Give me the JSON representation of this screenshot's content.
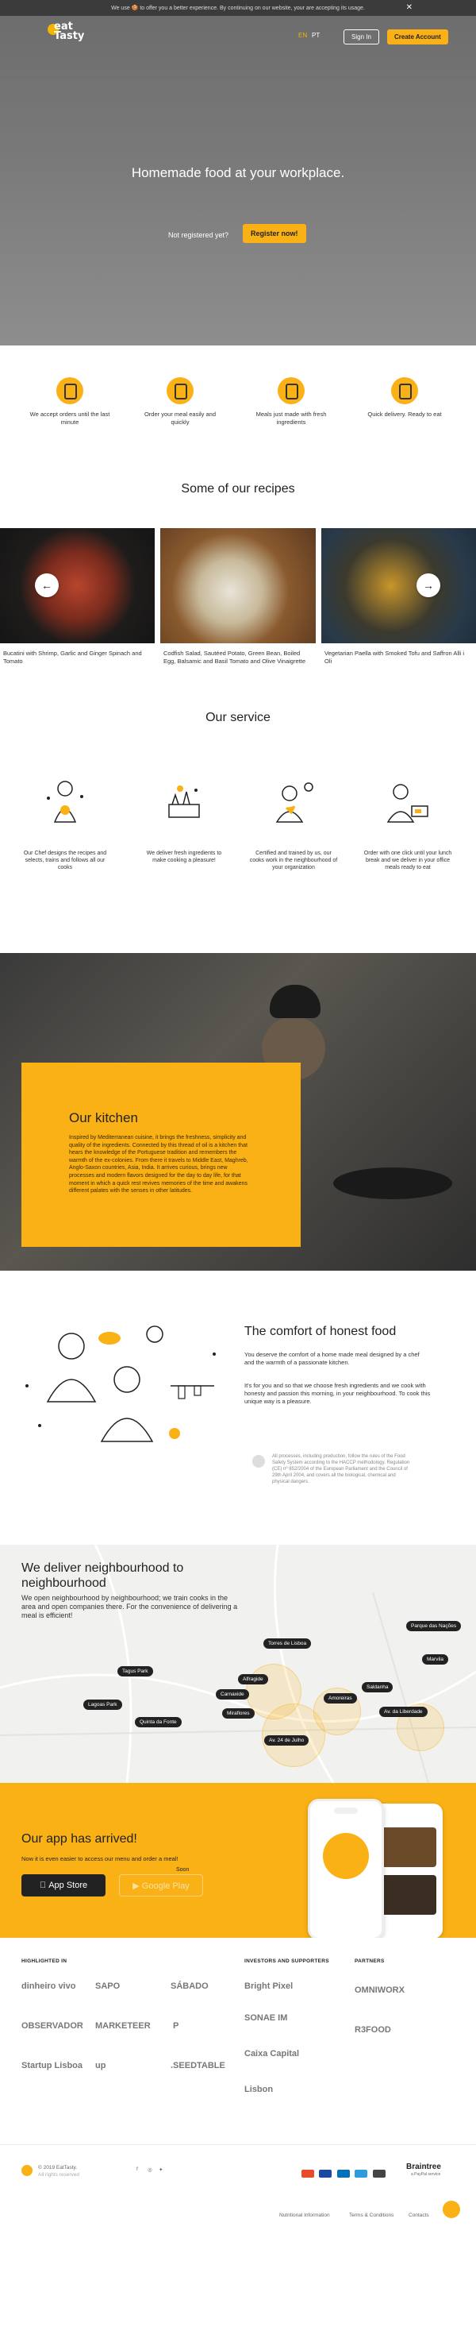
{
  "cookie": {
    "text": "We use 🍪 to offer you a better experience. By continuing on our website, your are accepting its usage.",
    "close": "✕"
  },
  "header": {
    "logo_top": "eat",
    "logo_bottom": "Tasty",
    "langs": [
      "EN",
      "PT"
    ],
    "signin": "Sign In",
    "create_account": "Create Account"
  },
  "hero": {
    "title": "Homemade food at your workplace.",
    "not_registered": "Not registered yet?",
    "register": "Register now!"
  },
  "features": [
    {
      "text": "We accept orders until the last minute",
      "icon": "clock-icon"
    },
    {
      "text": "Order your meal easily and quickly",
      "icon": "tap-icon"
    },
    {
      "text": "Meals just made with fresh ingredients",
      "icon": "leaf-icon"
    },
    {
      "text": "Quick delivery. Ready to eat",
      "icon": "delivery-box-icon"
    }
  ],
  "recipes": {
    "title": "Some of our recipes",
    "items": [
      {
        "caption": "Bucatini with Shrimp, Garlic and Ginger Spinach and Tomato"
      },
      {
        "caption": "Codfish Salad, Sautéed Potato, Green Bean, Boiled Egg, Balsamic and Basil Tomato and Olive Vinaigrette"
      },
      {
        "caption": "Vegetarian Paella with Smoked Tofu and Saffron Alli i Oli"
      }
    ],
    "prev": "←",
    "next": "→"
  },
  "service": {
    "title": "Our service",
    "items": [
      {
        "text": "Our Chef designs the recipes and selects, trains and follows all our cooks"
      },
      {
        "text": "We deliver fresh ingredients to make cooking a pleasure!"
      },
      {
        "text": "Certified and trained by us, our cooks work in the neighbourhood of your organization"
      },
      {
        "text": "Order with one click until your lunch break and we deliver in your office meals ready to eat"
      }
    ]
  },
  "kitchen": {
    "title": "Our kitchen",
    "text": "Inspired by Mediterranean cuisine, it brings the freshness, simplicity and quality of the ingredients. Connected by this thread of oil is a kitchen that hears the knowledge of the Portuguese tradition and remembers the warmth of the ex-colonies. From there it travels to Middle East, Maghreb, Anglo-Saxon countries, Asia, India. It arrives curious, brings new processes and modern flavors designed for the day to day life, for that moment in which a quick rest revives memories of the time and awakens different palates with the senses in other latitudes."
  },
  "comfort": {
    "title": "The comfort of honest food",
    "p1": "You deserve the comfort of a home made meal designed by a chef and the warmth of a passionate kitchen.",
    "p2": "It's for you and so that we choose fresh ingredients and we cook with honesty and passion this morning, in your neighbourhood. To cook this unique way is a pleasure.",
    "note": "All processes, including production, follow the rules of the Food Safety System according to the HACCP methodology. Regulation (CE) nº 852/2004 of the European Parliament and the Council of 29th April 2004, and covers all the biological, chemical and physical dangers."
  },
  "map": {
    "title": "We deliver neighbourhood to neighbourhood",
    "text": "We open neighbourhood by neighbourhood; we train cooks in the area and open companies there. For the convenience of delivering a meal is efficient!",
    "pins": [
      "Parque das Nações",
      "Torres de Lisboa",
      "Marvila",
      "Tagus Park",
      "Alfragide",
      "Saldanha",
      "Lagoas Park",
      "Carnaxide",
      "Amoreiras",
      "Av. da Liberdade",
      "Quinta da Fonte",
      "Miraflores",
      "Av. 24 de Julho"
    ]
  },
  "app": {
    "title": "Our app has arrived!",
    "text": "Now it is even easier to access our menu and order a meal!",
    "soon": "Soon",
    "appstore": "App Store",
    "gplay": "Google Play"
  },
  "partners": {
    "highlighted_title": "HIGHLIGHTED IN",
    "investors_title": "INVESTORS AND SUPPORTERS",
    "partners_title": "PARTNERS",
    "highlighted": [
      "dinheiro vivo",
      "SAPO",
      "SÁBADO",
      "OBSERVADOR",
      "MARKETEER",
      "P",
      "Startup Lisboa",
      "up",
      ".SEEDTABLE"
    ],
    "investors": [
      "Bright Pixel",
      "SONAE IM",
      "Caixa Capital",
      "Lisbon"
    ],
    "partners": [
      "OMNIWORX",
      "R3FOOD"
    ]
  },
  "footer": {
    "copyright": "© 2019 EatTasty.",
    "rights": "All rights reserved",
    "links": [
      "Nutritional Information",
      "Terms & Conditions",
      "Contacts"
    ],
    "braintree": "Braintree",
    "braintree_sub": "a PayPal service"
  },
  "colors": {
    "accent": "#f9b115",
    "dark": "#222222"
  }
}
